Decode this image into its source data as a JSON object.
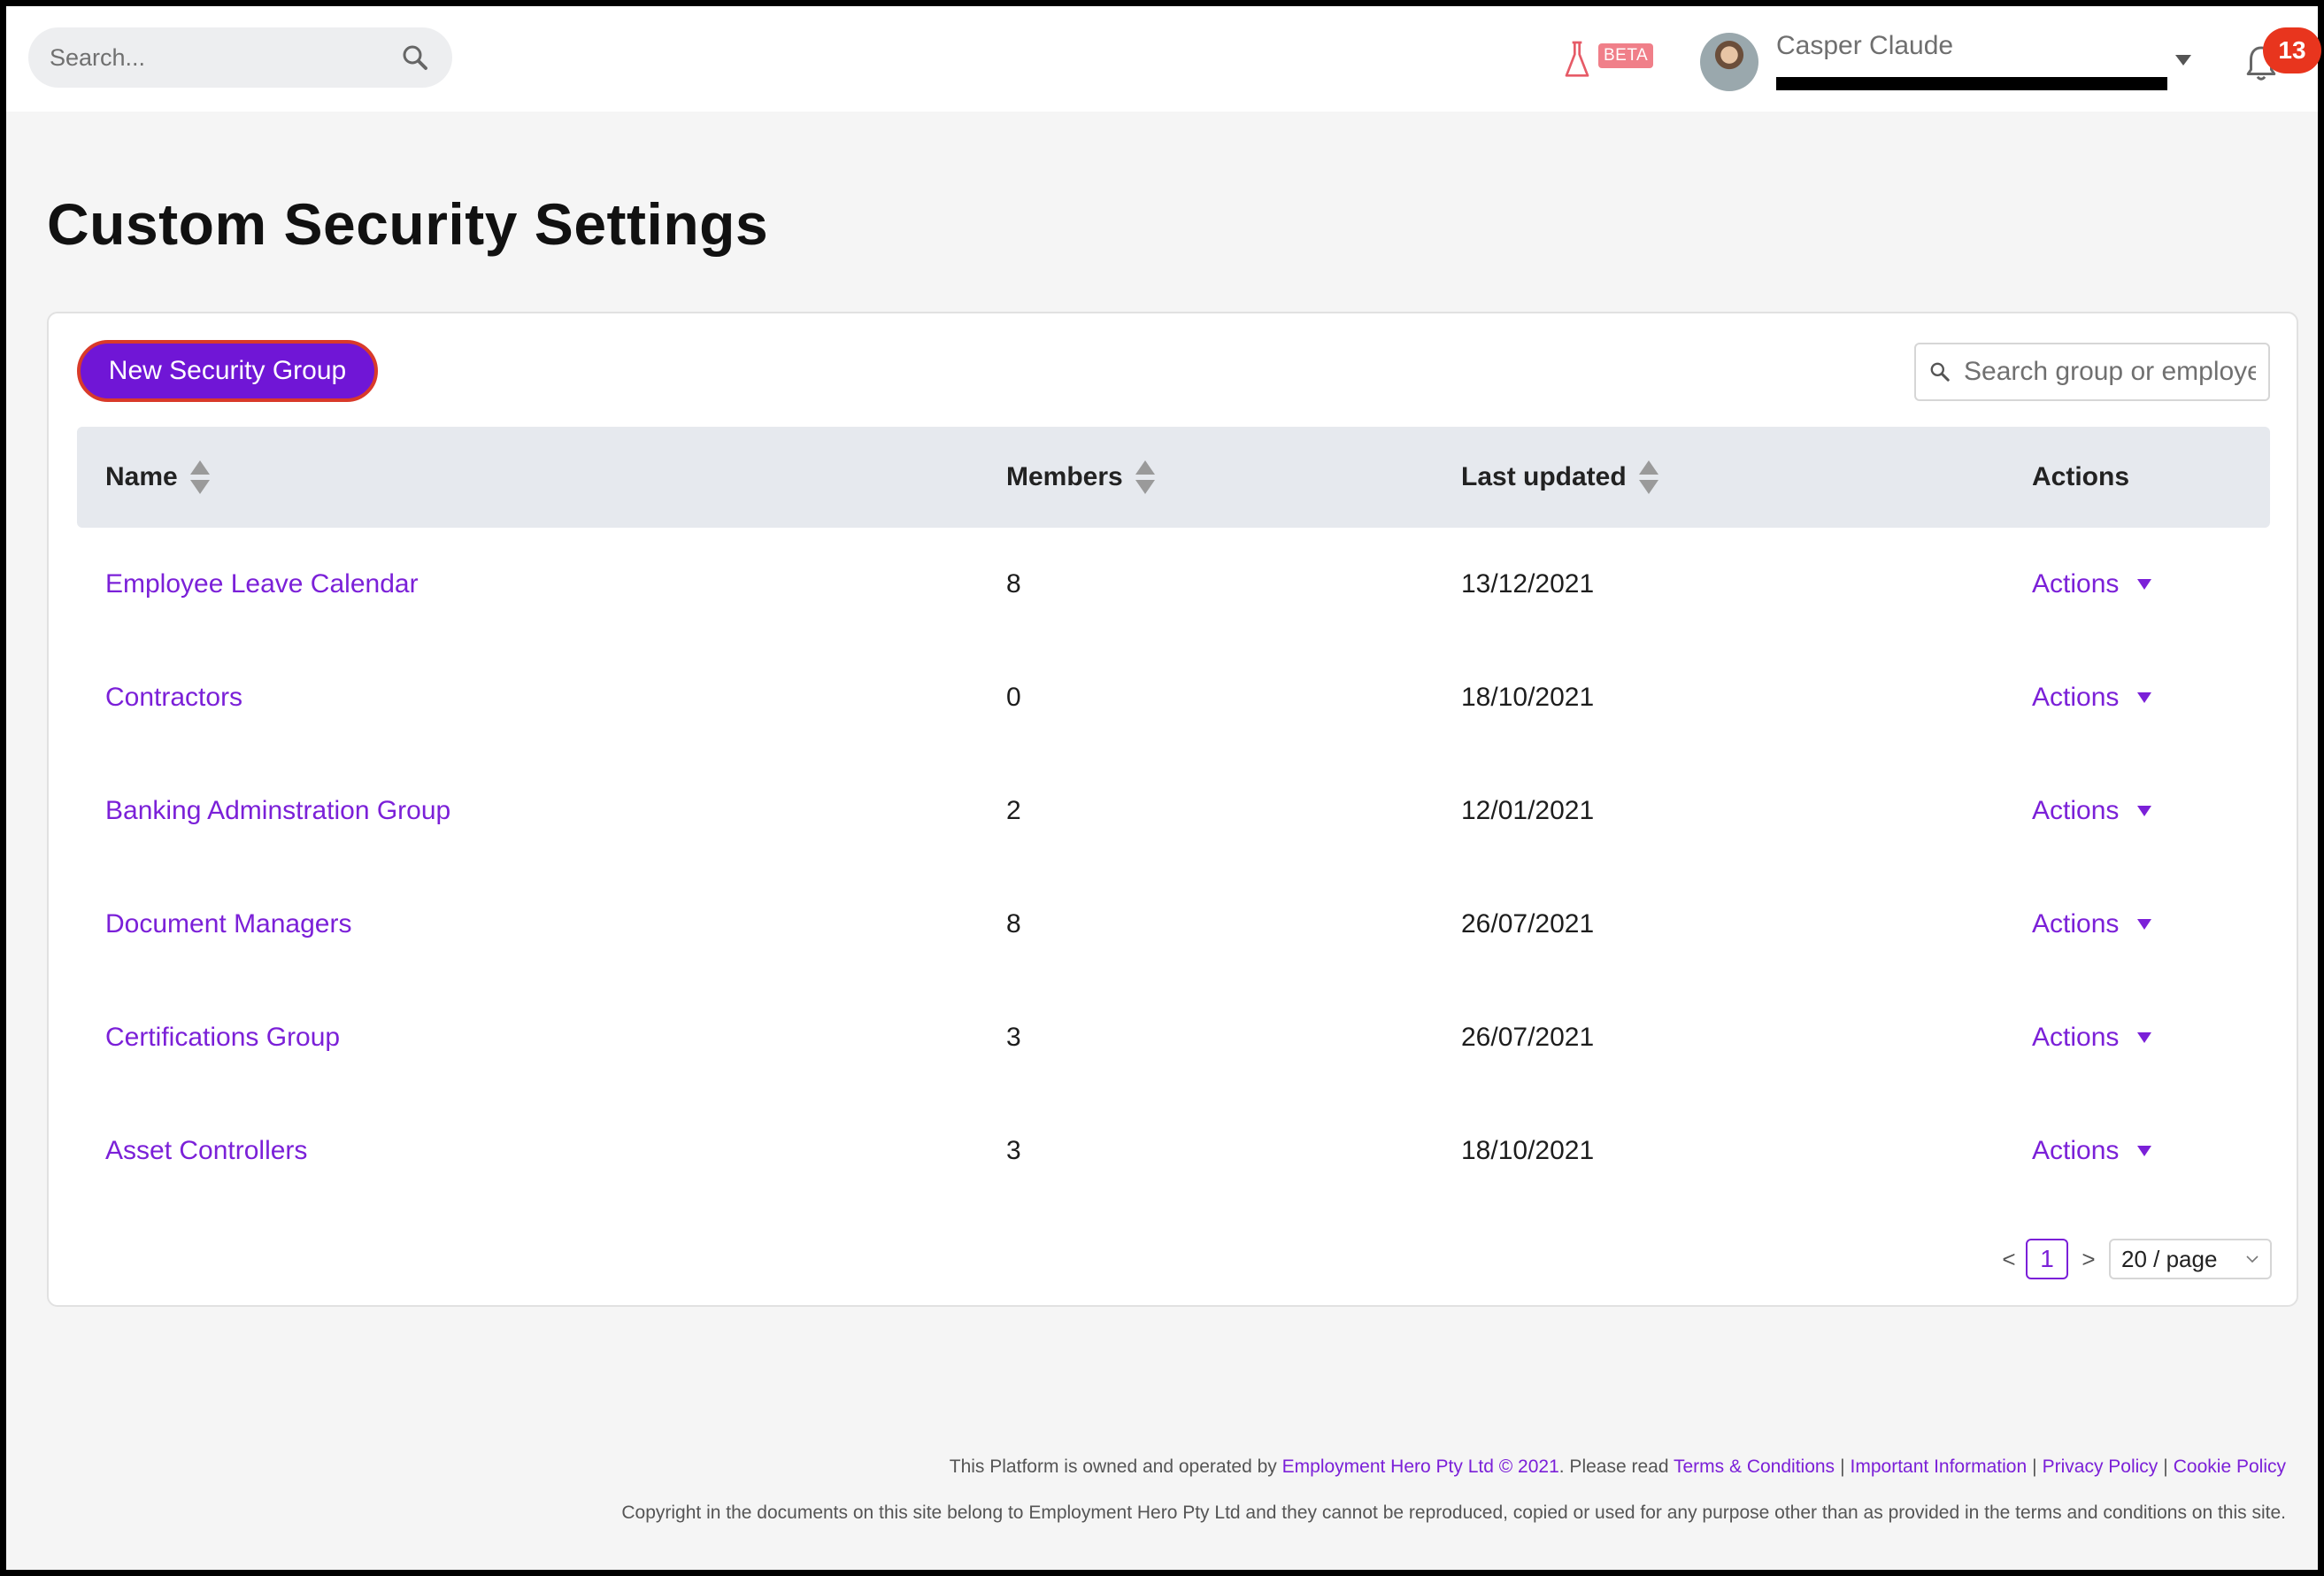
{
  "header": {
    "search_placeholder": "Search...",
    "beta_label": "BETA",
    "user_name": "Casper Claude",
    "notification_count": "13"
  },
  "page": {
    "title": "Custom Security Settings"
  },
  "toolbar": {
    "new_group_label": "New Security Group",
    "search_placeholder": "Search group or employee"
  },
  "table": {
    "columns": [
      "Name",
      "Members",
      "Last updated",
      "Actions"
    ],
    "rows": [
      {
        "name": "Employee Leave Calendar",
        "members": "8",
        "updated": "13/12/2021",
        "action": "Actions"
      },
      {
        "name": "Contractors",
        "members": "0",
        "updated": "18/10/2021",
        "action": "Actions"
      },
      {
        "name": "Banking Adminstration Group",
        "members": "2",
        "updated": "12/01/2021",
        "action": "Actions"
      },
      {
        "name": "Document Managers",
        "members": "8",
        "updated": "26/07/2021",
        "action": "Actions"
      },
      {
        "name": "Certifications Group",
        "members": "3",
        "updated": "26/07/2021",
        "action": "Actions"
      },
      {
        "name": "Asset Controllers",
        "members": "3",
        "updated": "18/10/2021",
        "action": "Actions"
      }
    ]
  },
  "pagination": {
    "prev": "<",
    "current": "1",
    "next": ">",
    "page_size": "20 / page"
  },
  "footer": {
    "line1_prefix": "This Platform is owned and operated by",
    "company_link": "Employment Hero Pty Ltd © 2021",
    "please_read": ". Please read",
    "terms": "Terms & Conditions",
    "important": "Important Information",
    "privacy": "Privacy Policy",
    "cookie": "Cookie Policy",
    "separator": "|",
    "line2": "Copyright in the documents on this site belong to Employment Hero Pty Ltd and they cannot be reproduced, copied or used for any purpose other than as provided in the terms and conditions on this site."
  },
  "colors": {
    "accent": "#7b20d8",
    "button": "#7016d6",
    "notification": "#e8351e"
  }
}
